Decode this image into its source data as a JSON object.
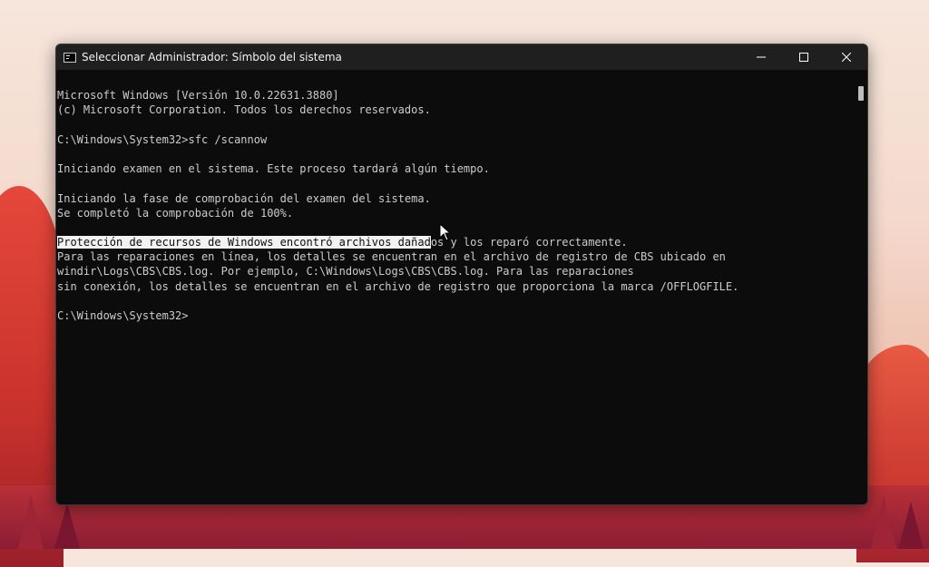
{
  "window": {
    "title": "Seleccionar Administrador: Símbolo del sistema",
    "controls": {
      "minimize": "minimize-icon",
      "maximize": "maximize-icon",
      "close": "close-icon"
    }
  },
  "console": {
    "lines": [
      "Microsoft Windows [Versión 10.0.22631.3880]",
      "(c) Microsoft Corporation. Todos los derechos reservados.",
      "",
      "C:\\Windows\\System32>sfc /scannow",
      "",
      "Iniciando examen en el sistema. Este proceso tardará algún tiempo.",
      "",
      "Iniciando la fase de comprobación del examen del sistema.",
      "Se completó la comprobación de 100%.",
      "",
      "",
      "Para las reparaciones en línea, los detalles se encuentran en el archivo de registro de CBS ubicado en",
      "windir\\Logs\\CBS\\CBS.log. Por ejemplo, C:\\Windows\\Logs\\CBS\\CBS.log. Para las reparaciones",
      "sin conexión, los detalles se encuentran en el archivo de registro que proporciona la marca /OFFLOGFILE.",
      "",
      "C:\\Windows\\System32>"
    ],
    "highlighted_line": {
      "selected": "Protección de recursos de Windows encontró archivos dañad",
      "rest": "os y los reparó correctamente."
    }
  },
  "colors": {
    "console_bg": "#0c0c0c",
    "console_text": "#cccccc",
    "titlebar_bg": "#1f1f1f",
    "selection_bg": "#f2f2f2"
  }
}
